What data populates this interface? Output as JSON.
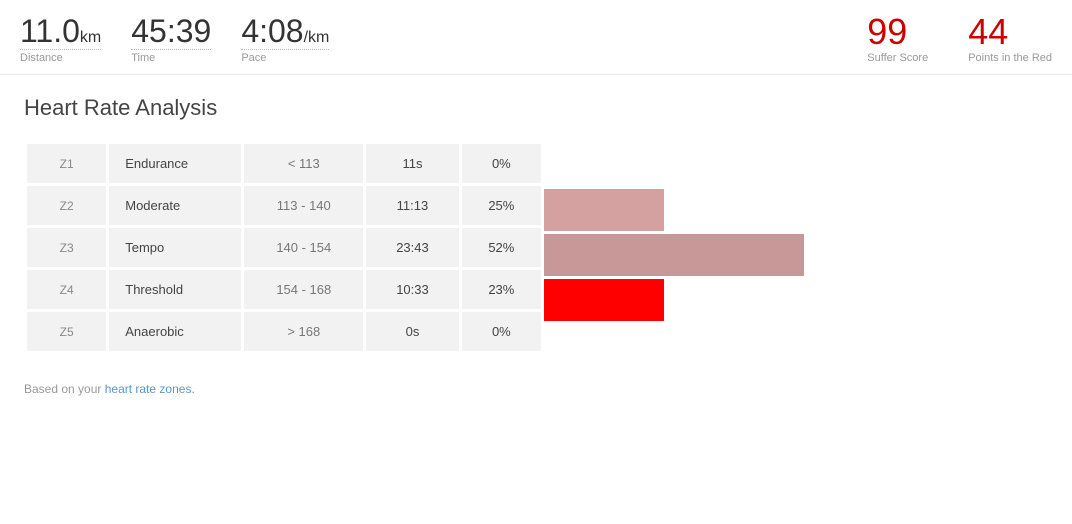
{
  "header": {
    "distance": {
      "value": "11.0",
      "unit": "km",
      "label": "Distance"
    },
    "time": {
      "value": "45:39",
      "label": "Time"
    },
    "pace": {
      "value": "4:08",
      "unit": "/km",
      "label": "Pace"
    },
    "suffer_score": {
      "value": "99",
      "label": "Suffer Score"
    },
    "points_in_red": {
      "value": "44",
      "label": "Points in the Red"
    }
  },
  "section_title": "Heart Rate Analysis",
  "zones": [
    {
      "id": "Z1",
      "name": "Endurance",
      "range": "< 113",
      "time": "11s",
      "percent": "0%",
      "bar_type": "empty"
    },
    {
      "id": "Z2",
      "name": "Moderate",
      "range": "113 - 140",
      "time": "11:13",
      "percent": "25%",
      "bar_type": "pink-z2"
    },
    {
      "id": "Z3",
      "name": "Tempo",
      "range": "140 - 154",
      "time": "23:43",
      "percent": "52%",
      "bar_type": "pink-z3"
    },
    {
      "id": "Z4",
      "name": "Threshold",
      "range": "154 - 168",
      "time": "10:33",
      "percent": "23%",
      "bar_type": "red-z4"
    },
    {
      "id": "Z5",
      "name": "Anaerobic",
      "range": "> 168",
      "time": "0s",
      "percent": "0%",
      "bar_type": "empty"
    }
  ],
  "footer": {
    "text": "Based on your ",
    "link_text": "heart rate zones.",
    "link_href": "#"
  }
}
